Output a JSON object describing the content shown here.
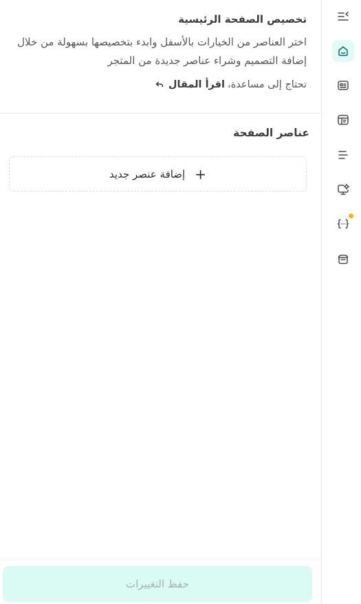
{
  "header": {
    "title": "تخصيص الصفحة الرئيسية",
    "description": "اختر العناصر من الخيارات بالأسفل وابدء بتخصيصها بسهولة من خلال إضافة التصميم وشراء عناصر جديدة من المتجر",
    "help_text": "تحتاج إلى مساعدة،",
    "help_link": "اقرأ المقال"
  },
  "section": {
    "title": "عناصر الصفحة",
    "add_button": "إضافة عنصر جديد",
    "add_icon": "+"
  },
  "footer": {
    "save_button": "حفظ التغييرات"
  },
  "rail": {
    "items": [
      {
        "icon": "collapse-menu-icon",
        "active": false
      },
      {
        "icon": "home-icon",
        "active": true
      },
      {
        "icon": "id-card-icon",
        "active": false
      },
      {
        "icon": "layout-icon",
        "active": false
      },
      {
        "icon": "menu-lines-icon",
        "active": false
      },
      {
        "icon": "monitor-settings-icon",
        "active": false
      },
      {
        "icon": "code-braces-icon",
        "active": false,
        "badge": true
      },
      {
        "icon": "store-icon",
        "active": false
      }
    ]
  },
  "colors": {
    "accent_bg": "#e3fbf5",
    "accent": "#0f6b61",
    "badge": "#f5b400",
    "save_bg": "#d9fbf3"
  }
}
